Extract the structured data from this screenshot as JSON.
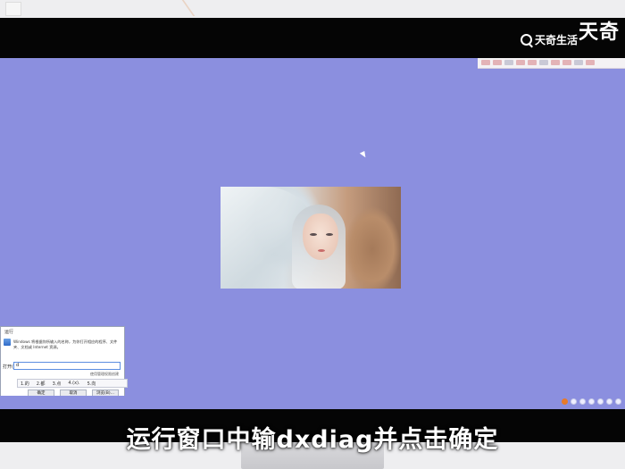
{
  "watermark": {
    "top_text": "天奇",
    "brand_text": "天奇生活"
  },
  "desktop": {
    "background_color": "#8b8fdf",
    "wallpaper_icon": "anime-girl-hooded-image"
  },
  "run_dialog": {
    "title": "运行",
    "description": "Windows 将根据你所输入的名称，为你打开相应的程序、文件夹、文档或 Internet 资源。",
    "open_label": "打开(O):",
    "input_value": "d",
    "hint": "使用管理权限创建",
    "ime_candidates": [
      "1.的",
      "2.都",
      "3.点",
      "4.(x).",
      "5.向"
    ],
    "buttons": {
      "ok": "确定",
      "cancel": "取消",
      "browse": "浏览(B)..."
    }
  },
  "subtitle": "运行窗口中输dxdiag并点击确定"
}
